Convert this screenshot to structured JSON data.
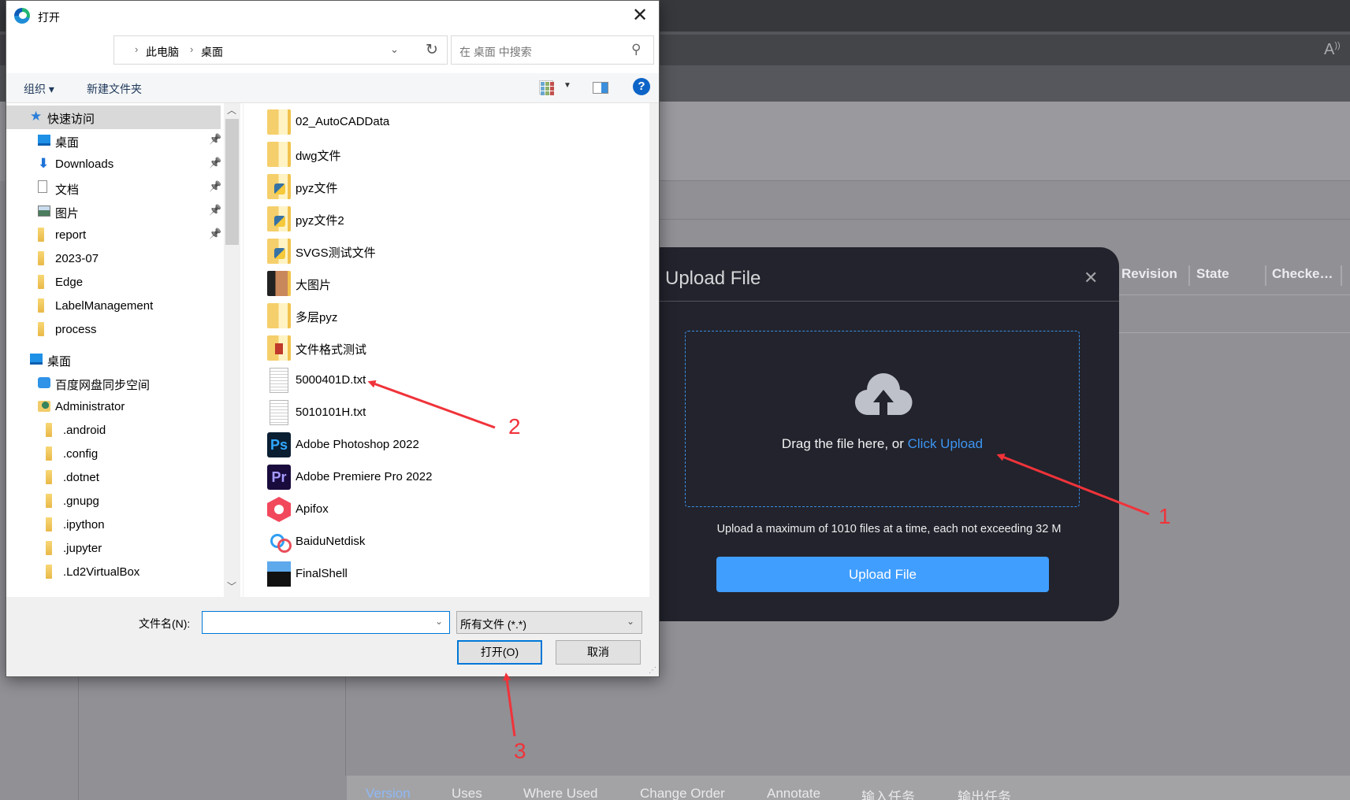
{
  "background_app": {
    "read_aloud_icon": "read-aloud-icon",
    "table_headers": [
      "Revision",
      "State",
      "Checke…"
    ],
    "bottom_tabs": [
      {
        "label": "Version",
        "active": true
      },
      {
        "label": "Uses",
        "active": false
      },
      {
        "label": "Where Used",
        "active": false
      },
      {
        "label": "Change Order",
        "active": false
      },
      {
        "label": "Annotate",
        "active": false
      },
      {
        "label": "输入任务",
        "active": false
      },
      {
        "label": "输出任务",
        "active": false
      }
    ]
  },
  "dialog": {
    "title": "打开",
    "close_glyph": "✕",
    "nav": {
      "back": "←",
      "forward": "→",
      "recent": "⌄",
      "up": "↑"
    },
    "breadcrumb": [
      "此电脑",
      "桌面"
    ],
    "refresh_glyph": "↻",
    "search_placeholder": "在 桌面 中搜索",
    "toolbar": {
      "organize": "组织 ▾",
      "new_folder": "新建文件夹",
      "help": "?"
    },
    "nav_pane": {
      "items": [
        {
          "label": "快速访问",
          "icon": "star",
          "selected": true,
          "pinned": false,
          "indent": 1
        },
        {
          "label": "桌面",
          "icon": "desktop",
          "pinned": true,
          "indent": 2
        },
        {
          "label": "Downloads",
          "icon": "download",
          "pinned": true,
          "indent": 2
        },
        {
          "label": "文档",
          "icon": "document",
          "pinned": true,
          "indent": 2
        },
        {
          "label": "图片",
          "icon": "pictures",
          "pinned": true,
          "indent": 2
        },
        {
          "label": "report",
          "icon": "folder",
          "pinned": true,
          "indent": 2
        },
        {
          "label": "2023-07",
          "icon": "folder",
          "pinned": false,
          "indent": 2
        },
        {
          "label": "Edge",
          "icon": "folder",
          "pinned": false,
          "indent": 2
        },
        {
          "label": "LabelManagement",
          "icon": "folder",
          "pinned": false,
          "indent": 2
        },
        {
          "label": "process",
          "icon": "folder",
          "pinned": false,
          "indent": 2
        },
        {
          "label": "桌面",
          "icon": "desktop",
          "pinned": false,
          "indent": 1,
          "gap": true
        },
        {
          "label": "百度网盘同步空间",
          "icon": "baidu",
          "pinned": false,
          "indent": 2
        },
        {
          "label": "Administrator",
          "icon": "user",
          "pinned": false,
          "indent": 2
        },
        {
          "label": ".android",
          "icon": "folder",
          "pinned": false,
          "indent": 3
        },
        {
          "label": ".config",
          "icon": "folder",
          "pinned": false,
          "indent": 3
        },
        {
          "label": ".dotnet",
          "icon": "folder",
          "pinned": false,
          "indent": 3
        },
        {
          "label": ".gnupg",
          "icon": "folder",
          "pinned": false,
          "indent": 3
        },
        {
          "label": ".ipython",
          "icon": "folder",
          "pinned": false,
          "indent": 3
        },
        {
          "label": ".jupyter",
          "icon": "folder",
          "pinned": false,
          "indent": 3
        },
        {
          "label": ".Ld2VirtualBox",
          "icon": "folder",
          "pinned": false,
          "indent": 3
        }
      ]
    },
    "files": [
      {
        "name": "02_AutoCADData",
        "type": "folder"
      },
      {
        "name": "dwg文件",
        "type": "folder"
      },
      {
        "name": "pyz文件",
        "type": "pyz-folder"
      },
      {
        "name": "pyz文件2",
        "type": "pyz-folder"
      },
      {
        "name": "SVGS测试文件",
        "type": "pyz-folder"
      },
      {
        "name": "大图片",
        "type": "image-folder"
      },
      {
        "name": "多层pyz",
        "type": "folder"
      },
      {
        "name": "文件格式测试",
        "type": "format-folder"
      },
      {
        "name": "5000401D.txt",
        "type": "txt"
      },
      {
        "name": "5010101H.txt",
        "type": "txt"
      },
      {
        "name": "Adobe Photoshop 2022",
        "type": "ps",
        "glyph": "Ps"
      },
      {
        "name": "Adobe Premiere Pro 2022",
        "type": "pr",
        "glyph": "Pr"
      },
      {
        "name": "Apifox",
        "type": "apifox"
      },
      {
        "name": "BaiduNetdisk",
        "type": "baidu"
      },
      {
        "name": "FinalShell",
        "type": "finalshell"
      }
    ],
    "filename_label": "文件名(N):",
    "filename_value": "",
    "filetype_value": "所有文件 (*.*)",
    "open_button": "打开(O)",
    "cancel_button": "取消"
  },
  "upload_modal": {
    "title": "Upload File",
    "close_glyph": "✕",
    "drop_text": "Drag the file here, or ",
    "drop_link": "Click Upload",
    "limit_text": "Upload a maximum of 1010 files at a time, each not exceeding 32 M",
    "upload_button": "Upload File",
    "accent_color": "#409eff"
  },
  "annotations": [
    "1",
    "2",
    "3"
  ]
}
